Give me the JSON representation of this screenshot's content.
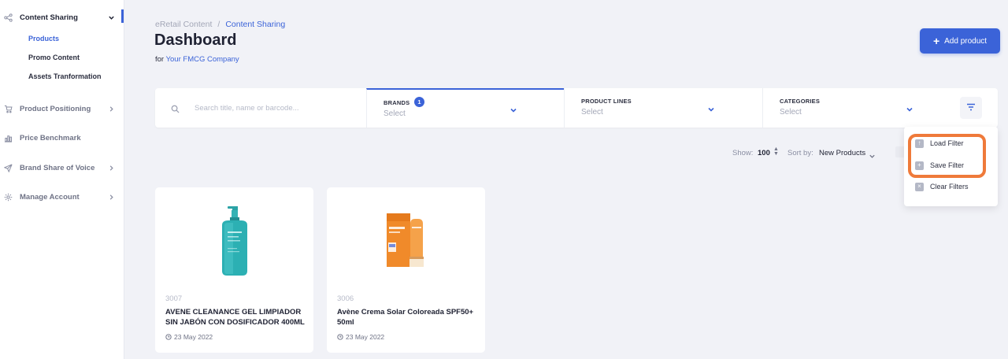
{
  "sidebar": {
    "items": [
      {
        "label": "Content Sharing",
        "icon": "share-icon",
        "expanded": true
      },
      {
        "label": "Product Positioning",
        "icon": "cart-icon"
      },
      {
        "label": "Price Benchmark",
        "icon": "bar-chart-icon"
      },
      {
        "label": "Brand Share of Voice",
        "icon": "send-icon"
      },
      {
        "label": "Manage Account",
        "icon": "gear-icon"
      }
    ],
    "subitems": [
      {
        "label": "Products",
        "active": true
      },
      {
        "label": "Promo Content"
      },
      {
        "label": "Assets Tranformation"
      }
    ]
  },
  "breadcrumb": {
    "root": "eRetail Content",
    "separator": "/",
    "current": "Content Sharing"
  },
  "header": {
    "title": "Dashboard",
    "subtitle_prefix": "for",
    "company": "Your FMCG Company",
    "add_button": "Add product"
  },
  "filters": {
    "search_placeholder": "Search title, name or barcode...",
    "brands": {
      "label": "BRANDS",
      "value": "Select",
      "badge": "1"
    },
    "product_lines": {
      "label": "PRODUCT LINES",
      "value": "Select"
    },
    "categories": {
      "label": "CATEGORIES",
      "value": "Select"
    }
  },
  "list_controls": {
    "show_label": "Show:",
    "show_value": "100",
    "sort_label": "Sort by:",
    "sort_value": "New Products"
  },
  "filter_menu": {
    "items": [
      {
        "label": "Load Filter",
        "icon": "load-icon"
      },
      {
        "label": "Save Filter",
        "icon": "save-icon"
      },
      {
        "label": "Clear Filters",
        "icon": "clear-icon"
      }
    ]
  },
  "products": [
    {
      "code": "3007",
      "name": "AVENE CLEANANCE GEL LIMPIADOR SIN JABÓN CON DOSIFICADOR 400ML",
      "date": "23 May 2022"
    },
    {
      "code": "3006",
      "name": "Avène Crema Solar Coloreada SPF50+ 50ml",
      "date": "23 May 2022"
    }
  ],
  "colors": {
    "accent": "#3b63d8",
    "highlight": "#ef7a3a",
    "background": "#f1f2f7"
  }
}
